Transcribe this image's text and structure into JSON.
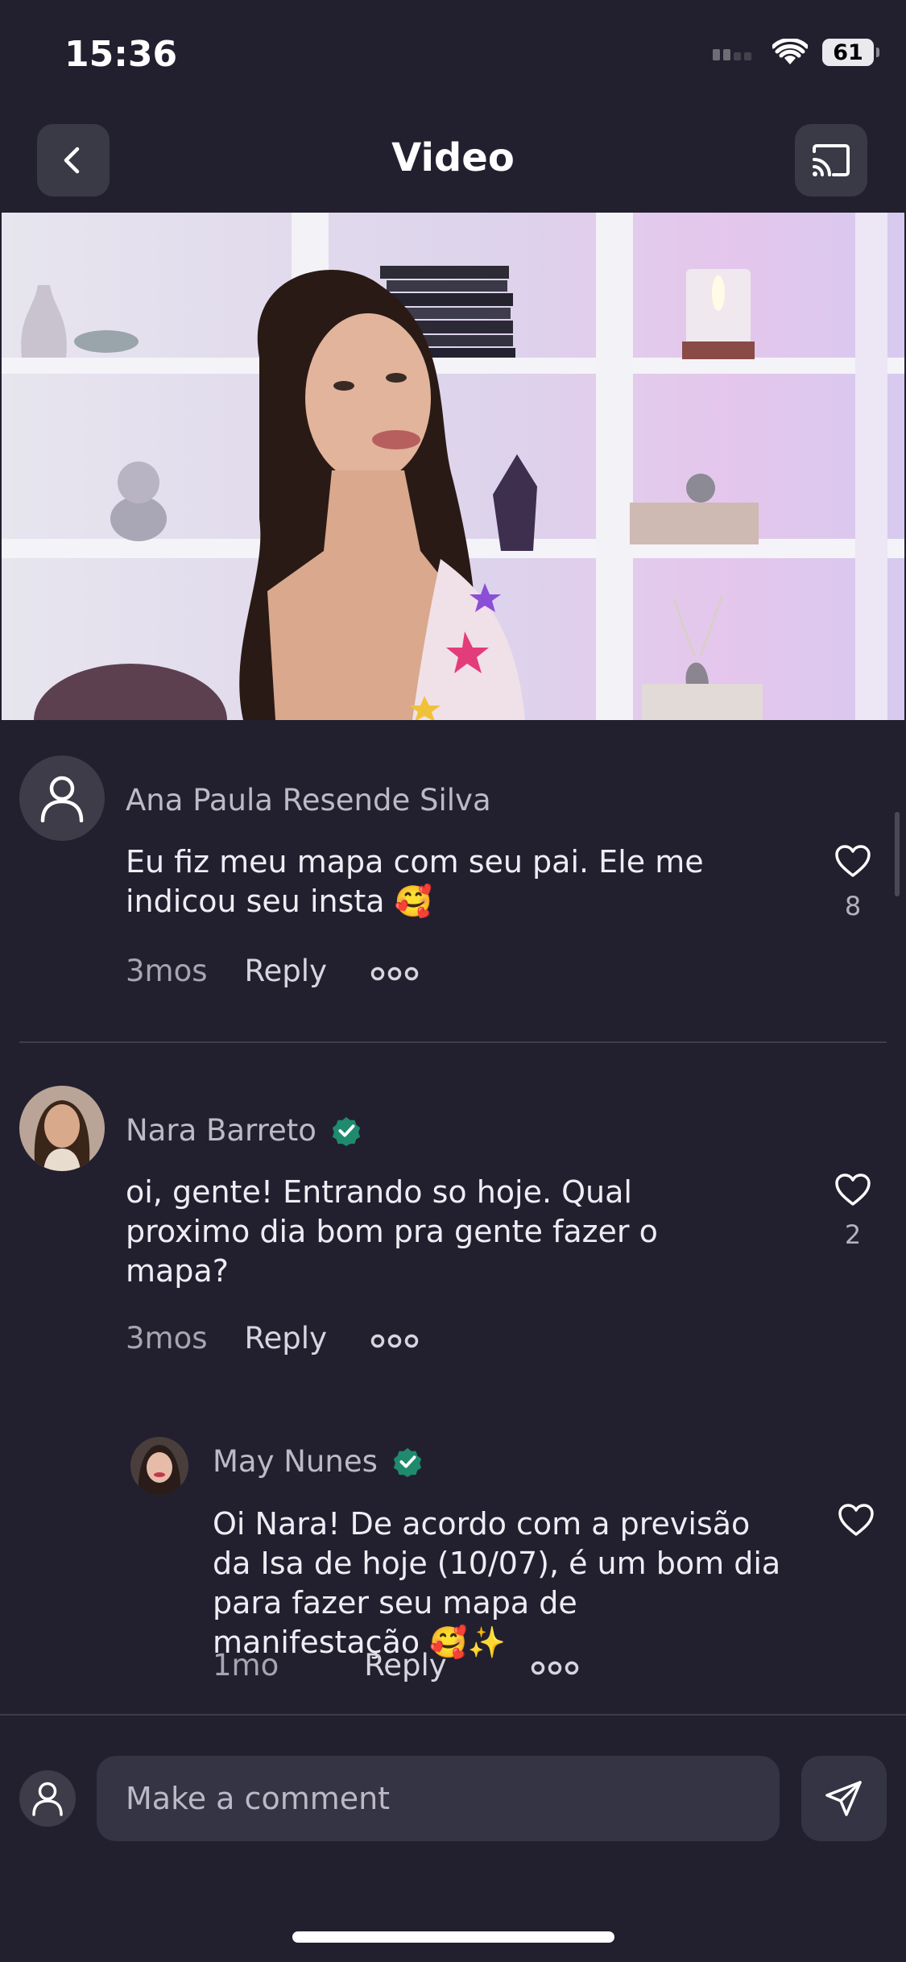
{
  "status_bar": {
    "time": "15:36",
    "battery": "61"
  },
  "nav": {
    "title": "Video"
  },
  "comments": [
    {
      "author": "Ana Paula Resende Silva",
      "verified": false,
      "text": "Eu fiz meu mapa com seu pai. Ele me indicou seu insta 🥰",
      "time": "3mos",
      "reply_label": "Reply",
      "likes": "8"
    },
    {
      "author": "Nara Barreto",
      "verified": true,
      "text": "oi, gente! Entrando so hoje. Qual proximo dia bom pra gente fazer o mapa?",
      "time": "3mos",
      "reply_label": "Reply",
      "likes": "2"
    }
  ],
  "replies": [
    {
      "author": "May Nunes",
      "verified": true,
      "text": "Oi Nara! De acordo com a previsão da Isa de hoje (10/07), é um bom dia para fazer seu mapa de manifestação 🥰✨",
      "time": "1mo",
      "reply_label": "Reply"
    }
  ],
  "composer": {
    "placeholder": "Make a comment"
  },
  "colors": {
    "background": "#22202f",
    "verified": "#1f8a6e",
    "input": "#353444"
  }
}
